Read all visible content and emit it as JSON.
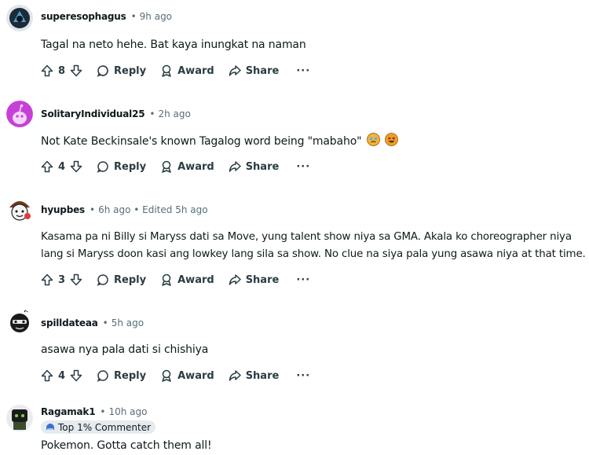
{
  "comments": [
    {
      "author": "superesophagus",
      "time": "9h ago",
      "text": "Tagal na neto hehe. Bat kaya inungkat na naman",
      "votes": "8"
    },
    {
      "author": "SolitaryIndividual25",
      "time": "2h ago",
      "text": "Not Kate Beckinsale's known Tagalog word being \"mabaho\"",
      "votes": "4",
      "emojis": [
        "crying-face-emoji",
        "grinning-squint-face-emoji"
      ]
    },
    {
      "author": "hyupbes",
      "time": "6h ago • Edited 5h ago",
      "text_line1": "Kasama pa ni Billy si Maryss dati sa Move, yung talent show niya sa GMA. Akala ko choreographer niya",
      "text_line2": "lang si Maryss doon kasi ang lowkey lang sila sa show. No clue na siya pala yung asawa niya at that time.",
      "votes": "3"
    },
    {
      "author": "spilldateaa",
      "time": "5h ago",
      "text": "asawa nya pala dati si chishiya",
      "votes": "4"
    },
    {
      "author": "Ragamak1",
      "time": "10h ago",
      "badge": "Top 1% Commenter",
      "text": "Pokemon. Gotta catch them all!"
    }
  ],
  "actions": {
    "reply": "Reply",
    "award": "Award",
    "share": "Share",
    "more": "···"
  },
  "separator": "•"
}
